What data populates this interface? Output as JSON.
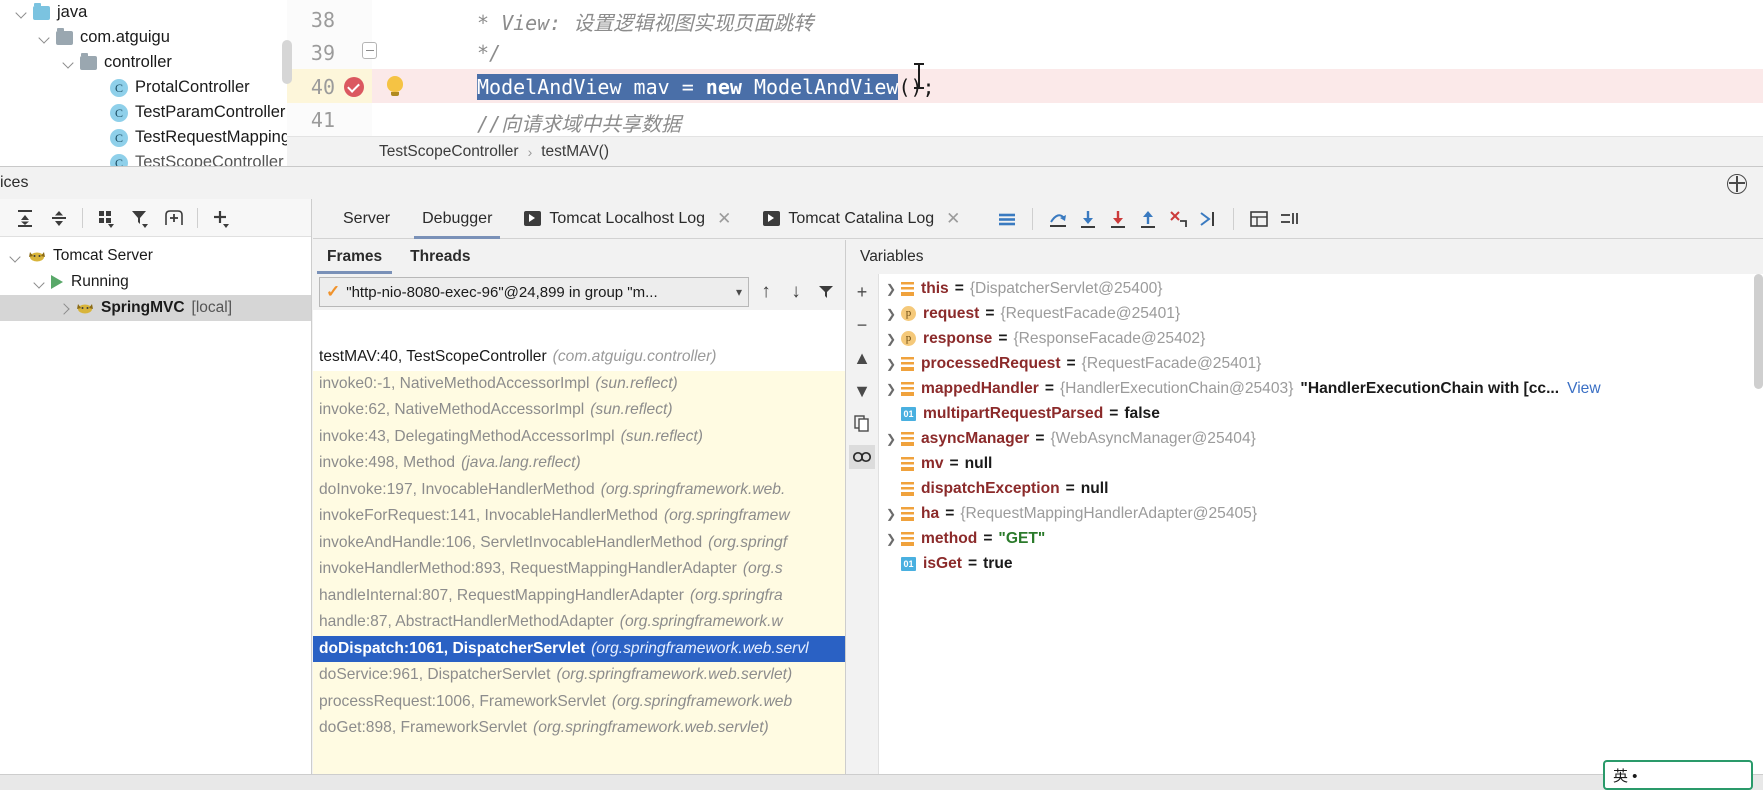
{
  "project_tree": {
    "items": [
      {
        "label": "java",
        "icon": "folder-icon",
        "depth": 0,
        "expanded": true,
        "color": "blue"
      },
      {
        "label": "com.atguigu",
        "icon": "package-icon",
        "depth": 1,
        "expanded": true,
        "color": "gray"
      },
      {
        "label": "controller",
        "icon": "package-icon",
        "depth": 2,
        "expanded": true,
        "color": "gray"
      },
      {
        "label": "ProtalController",
        "icon": "class-icon",
        "depth": 3
      },
      {
        "label": "TestParamController",
        "icon": "class-icon",
        "depth": 3
      },
      {
        "label": "TestRequestMappingC",
        "icon": "class-icon",
        "depth": 3
      },
      {
        "label": "TestScopeController",
        "icon": "class-icon",
        "depth": 3
      }
    ]
  },
  "editor": {
    "lines": [
      {
        "num": "38",
        "text": "* View: 设置逻辑视图实现页面跳转",
        "style": "comment"
      },
      {
        "num": "39",
        "text": "*/",
        "style": "comment"
      },
      {
        "num": "40",
        "text": "ModelAndView mav = new ModelAndView();",
        "style": "code",
        "highlighted": true
      },
      {
        "num": "41",
        "text": "//向请求域中共享数据",
        "style": "comment"
      }
    ],
    "selected_code": {
      "part1": "ModelAndView mav = ",
      "keyword": "new",
      "part2": " ModelAndView"
    },
    "after_selection": "();",
    "breakpoint_line": "40",
    "gutter_icons": [
      "breakpoint-checked-icon",
      "intention-bulb-icon",
      "code-fold-icon"
    ]
  },
  "breadcrumb": {
    "class": "TestScopeController",
    "separator": "›",
    "method": "testMAV()"
  },
  "services": {
    "title": "vices",
    "toolbar_icons": [
      "expand-all-icon",
      "collapse-all-icon",
      "group-by-icon",
      "filter-icon",
      "add-frame-icon",
      "add-icon"
    ],
    "tree": [
      {
        "label": "Tomcat Server",
        "icon": "tomcat-icon",
        "depth": 0,
        "expanded": true,
        "selected": false
      },
      {
        "label": "Running",
        "icon": "run-icon",
        "depth": 1,
        "expanded": true,
        "selected": false
      },
      {
        "label": "SpringMVC",
        "suffix": "[local]",
        "icon": "tomcat-icon",
        "depth": 2,
        "expanded": false,
        "selected": true
      }
    ]
  },
  "debugger": {
    "tabs": [
      {
        "label": "Server",
        "active": false,
        "icon": null,
        "closable": false
      },
      {
        "label": "Debugger",
        "active": true,
        "icon": null,
        "closable": false
      },
      {
        "label": "Tomcat Localhost Log",
        "active": false,
        "icon": "console-icon",
        "closable": true
      },
      {
        "label": "Tomcat Catalina Log",
        "active": false,
        "icon": "console-icon",
        "closable": true
      }
    ],
    "toolbar_icons": [
      "layout-lines-icon",
      "step-over-icon",
      "step-into-icon",
      "force-step-into-icon",
      "step-out-icon",
      "drop-frame-icon",
      "run-to-cursor-icon",
      "evaluate-icon",
      "settings-icon"
    ],
    "frames_panel": {
      "tabs": [
        {
          "label": "Frames",
          "active": true
        },
        {
          "label": "Threads",
          "active": false
        }
      ],
      "thread_selector": "\"http-nio-8080-exec-96\"@24,899 in group \"m...",
      "nav_icons": [
        "up-arrow-icon",
        "down-arrow-icon",
        "filter-icon"
      ],
      "frames": [
        {
          "method": "testMAV:40, TestScopeController",
          "pkg": "(com.atguigu.controller)",
          "state": "current"
        },
        {
          "method": "invoke0:-1, NativeMethodAccessorImpl",
          "pkg": "(sun.reflect)",
          "state": "lib"
        },
        {
          "method": "invoke:62, NativeMethodAccessorImpl",
          "pkg": "(sun.reflect)",
          "state": "lib"
        },
        {
          "method": "invoke:43, DelegatingMethodAccessorImpl",
          "pkg": "(sun.reflect)",
          "state": "lib"
        },
        {
          "method": "invoke:498, Method",
          "pkg": "(java.lang.reflect)",
          "state": "lib"
        },
        {
          "method": "doInvoke:197, InvocableHandlerMethod",
          "pkg": "(org.springframework.web.",
          "state": "lib"
        },
        {
          "method": "invokeForRequest:141, InvocableHandlerMethod",
          "pkg": "(org.springframew",
          "state": "lib"
        },
        {
          "method": "invokeAndHandle:106, ServletInvocableHandlerMethod",
          "pkg": "(org.springf",
          "state": "lib"
        },
        {
          "method": "invokeHandlerMethod:893, RequestMappingHandlerAdapter",
          "pkg": "(org.s",
          "state": "lib"
        },
        {
          "method": "handleInternal:807, RequestMappingHandlerAdapter",
          "pkg": "(org.springfra",
          "state": "lib"
        },
        {
          "method": "handle:87, AbstractHandlerMethodAdapter",
          "pkg": "(org.springframework.w",
          "state": "lib"
        },
        {
          "method": "doDispatch:1061, DispatcherServlet",
          "pkg": "(org.springframework.web.servl",
          "state": "selected"
        },
        {
          "method": "doService:961, DispatcherServlet",
          "pkg": "(org.springframework.web.servlet)",
          "state": "lib"
        },
        {
          "method": "processRequest:1006, FrameworkServlet",
          "pkg": "(org.springframework.web",
          "state": "lib"
        },
        {
          "method": "doGet:898, FrameworkServlet",
          "pkg": "(org.springframework.web.servlet)",
          "state": "lib"
        }
      ]
    },
    "variables_panel": {
      "title": "Variables",
      "gutter_icons": [
        "add-icon",
        "remove-icon",
        "up-icon",
        "down-icon",
        "copy-icon",
        "watches-icon"
      ],
      "rows": [
        {
          "expandable": true,
          "icon": "field-icon",
          "name": "this",
          "value": "{DispatcherServlet@25400}",
          "vstyle": "ref"
        },
        {
          "expandable": true,
          "icon": "param-icon",
          "name": "request",
          "value": "{RequestFacade@25401}",
          "vstyle": "ref"
        },
        {
          "expandable": true,
          "icon": "param-icon",
          "name": "response",
          "value": "{ResponseFacade@25402}",
          "vstyle": "ref"
        },
        {
          "expandable": true,
          "icon": "field-icon",
          "name": "processedRequest",
          "value": "{RequestFacade@25401}",
          "vstyle": "ref"
        },
        {
          "expandable": true,
          "icon": "field-icon",
          "name": "mappedHandler",
          "value": "{HandlerExecutionChain@25403}",
          "extra": "\"HandlerExecutionChain with [cc...",
          "link": "View",
          "vstyle": "ref"
        },
        {
          "expandable": false,
          "icon": "bool-icon",
          "name": "multipartRequestParsed",
          "value": "false",
          "vstyle": "lit"
        },
        {
          "expandable": true,
          "icon": "field-icon",
          "name": "asyncManager",
          "value": "{WebAsyncManager@25404}",
          "vstyle": "ref"
        },
        {
          "expandable": false,
          "icon": "field-icon",
          "name": "mv",
          "value": "null",
          "vstyle": "lit"
        },
        {
          "expandable": false,
          "icon": "field-icon",
          "name": "dispatchException",
          "value": "null",
          "vstyle": "lit"
        },
        {
          "expandable": true,
          "icon": "field-icon",
          "name": "ha",
          "value": "{RequestMappingHandlerAdapter@25405}",
          "vstyle": "ref"
        },
        {
          "expandable": true,
          "icon": "field-icon",
          "name": "method",
          "value": "\"GET\"",
          "vstyle": "strq"
        },
        {
          "expandable": false,
          "icon": "bool-icon",
          "name": "isGet",
          "value": "true",
          "vstyle": "lit"
        }
      ]
    }
  },
  "ime": {
    "label": "英 •"
  },
  "colors": {
    "selection_blue": "#4a6fa8",
    "frame_selected": "#2a61c4",
    "breakpoint_red": "#db5860",
    "tab_underline": "#7a91b8",
    "var_name_red": "#8b2a2a",
    "string_green": "#2a7a2a"
  }
}
